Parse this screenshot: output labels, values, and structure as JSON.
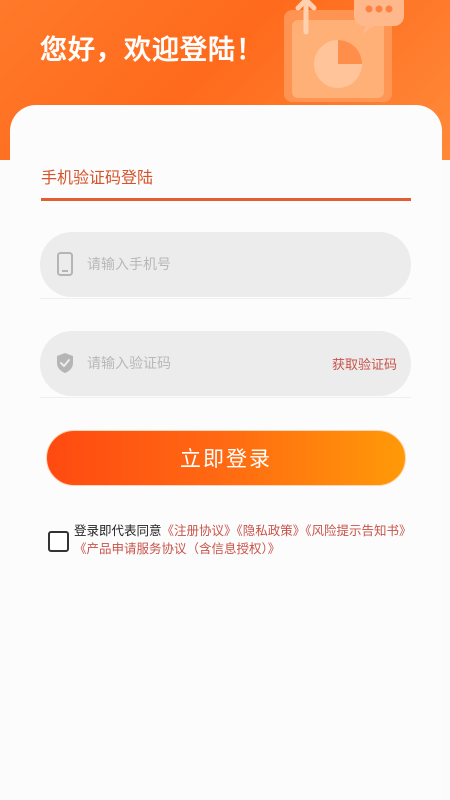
{
  "header": {
    "greeting": "您好，欢迎登陆！"
  },
  "login": {
    "tab_label": "手机验证码登陆",
    "phone_placeholder": "请输入手机号",
    "code_placeholder": "请输入验证码",
    "get_code_label": "获取验证码",
    "submit_label": "立即登录"
  },
  "agreement": {
    "checked": false,
    "prefix": "登录即代表同意",
    "links": [
      "《注册协议》",
      "《隐私政策》",
      "《风险提示告知书》",
      "《产品申请服务协议（含信息授权）》"
    ]
  },
  "colors": {
    "brand_orange": "#ff6a1c",
    "link_red": "#c8534a",
    "tab_underline": "#e25d33"
  },
  "icons": {
    "phone": "phone-icon",
    "shield": "shield-icon"
  }
}
